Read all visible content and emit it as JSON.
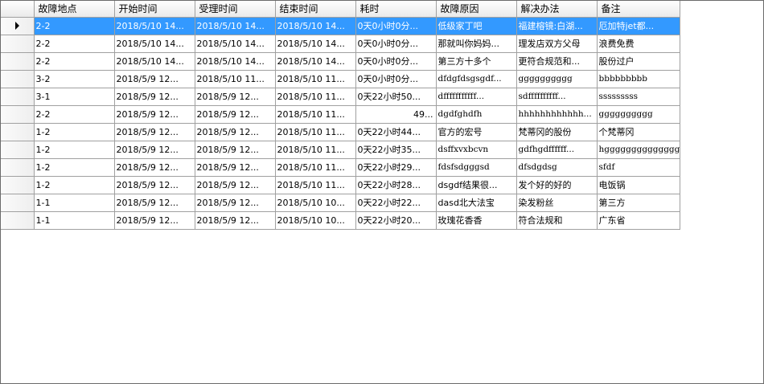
{
  "columns": [
    "故障地点",
    "开始时间",
    "受理时间",
    "结束时间",
    "耗时",
    "故障原因",
    "解决办法",
    "备注"
  ],
  "selected_row_indicator": "row-pointer-icon",
  "colors": {
    "selection": "#3399ff",
    "grid_line": "#a0a0a0",
    "header_bg": "#f0f0f0"
  },
  "rows": [
    {
      "place": "2-2",
      "start": "2018/5/10  14...",
      "accept": "2018/5/10  14...",
      "end": "2018/5/10  14...",
      "elapsed": "0天0小时0分...",
      "cause": "低级家丁吧",
      "solution": "福建榕镜:白湖...",
      "note": "厄加特jet都..."
    },
    {
      "place": "2-2",
      "start": "2018/5/10  14...",
      "accept": "2018/5/10  14...",
      "end": "2018/5/10  14...",
      "elapsed": "0天0小时0分...",
      "cause": "那就叫你妈妈...",
      "solution": "理发店双方父母",
      "note": "浪费免费"
    },
    {
      "place": "2-2",
      "start": "2018/5/10  14...",
      "accept": "2018/5/10  14...",
      "end": "2018/5/10  14...",
      "elapsed": "0天0小时0分...",
      "cause": "第三方十多个",
      "solution": "更符合规范和...",
      "note": "股份过户"
    },
    {
      "place": "3-2",
      "start": "2018/5/9   12...",
      "accept": "2018/5/10  11...",
      "end": "2018/5/10  11...",
      "elapsed": "0天0小时0分...",
      "cause": "dfdgfdsgsgdf...",
      "solution": "gggggggggg",
      "note": "bbbbbbbbb"
    },
    {
      "place": "3-1",
      "start": "2018/5/9   12...",
      "accept": "2018/5/9   12...",
      "end": "2018/5/10  11...",
      "elapsed": "0天22小时50...",
      "cause": "dfffffffffff...",
      "solution": "sdffffffffff...",
      "note": "sssssssss"
    },
    {
      "place": "2-2",
      "start": "2018/5/9   12...",
      "accept": "2018/5/9   12...",
      "end": "2018/5/10  11...",
      "elapsed": "49...",
      "cause": "dgdfghdfh",
      "solution": "hhhhhhhhhhhh...",
      "note": "gggggggggg"
    },
    {
      "place": "1-2",
      "start": "2018/5/9   12...",
      "accept": "2018/5/9   12...",
      "end": "2018/5/10  11...",
      "elapsed": "0天22小时44...",
      "cause": "官方的宏号",
      "solution": "梵蒂冈的股份",
      "note": "个梵蒂冈"
    },
    {
      "place": "1-2",
      "start": "2018/5/9   12...",
      "accept": "2018/5/9   12...",
      "end": "2018/5/10  11...",
      "elapsed": "0天22小时35...",
      "cause": "dsffxvxbcvn",
      "solution": "gdfhgdffffff...",
      "note": "hgggggggggggggg"
    },
    {
      "place": "1-2",
      "start": "2018/5/9   12...",
      "accept": "2018/5/9   12...",
      "end": "2018/5/10  11...",
      "elapsed": "0天22小时29...",
      "cause": "fdsfsdgggsd",
      "solution": "dfsdgdsg",
      "note": "sfdf"
    },
    {
      "place": "1-2",
      "start": "2018/5/9   12...",
      "accept": "2018/5/9   12...",
      "end": "2018/5/10  11...",
      "elapsed": "0天22小时28...",
      "cause": "dsgdf结果很...",
      "solution": "发个好的好的",
      "note": "电饭锅"
    },
    {
      "place": "1-1",
      "start": "2018/5/9   12...",
      "accept": "2018/5/9   12...",
      "end": "2018/5/10  10...",
      "elapsed": "0天22小时22...",
      "cause": "dasd北大法宝",
      "solution": "染发粉丝",
      "note": "第三方"
    },
    {
      "place": "1-1",
      "start": "2018/5/9   12...",
      "accept": "2018/5/9   12...",
      "end": "2018/5/10  10...",
      "elapsed": "0天22小时20...",
      "cause": "玫瑰花香香",
      "solution": "符合法规和",
      "note": "广东省"
    }
  ]
}
